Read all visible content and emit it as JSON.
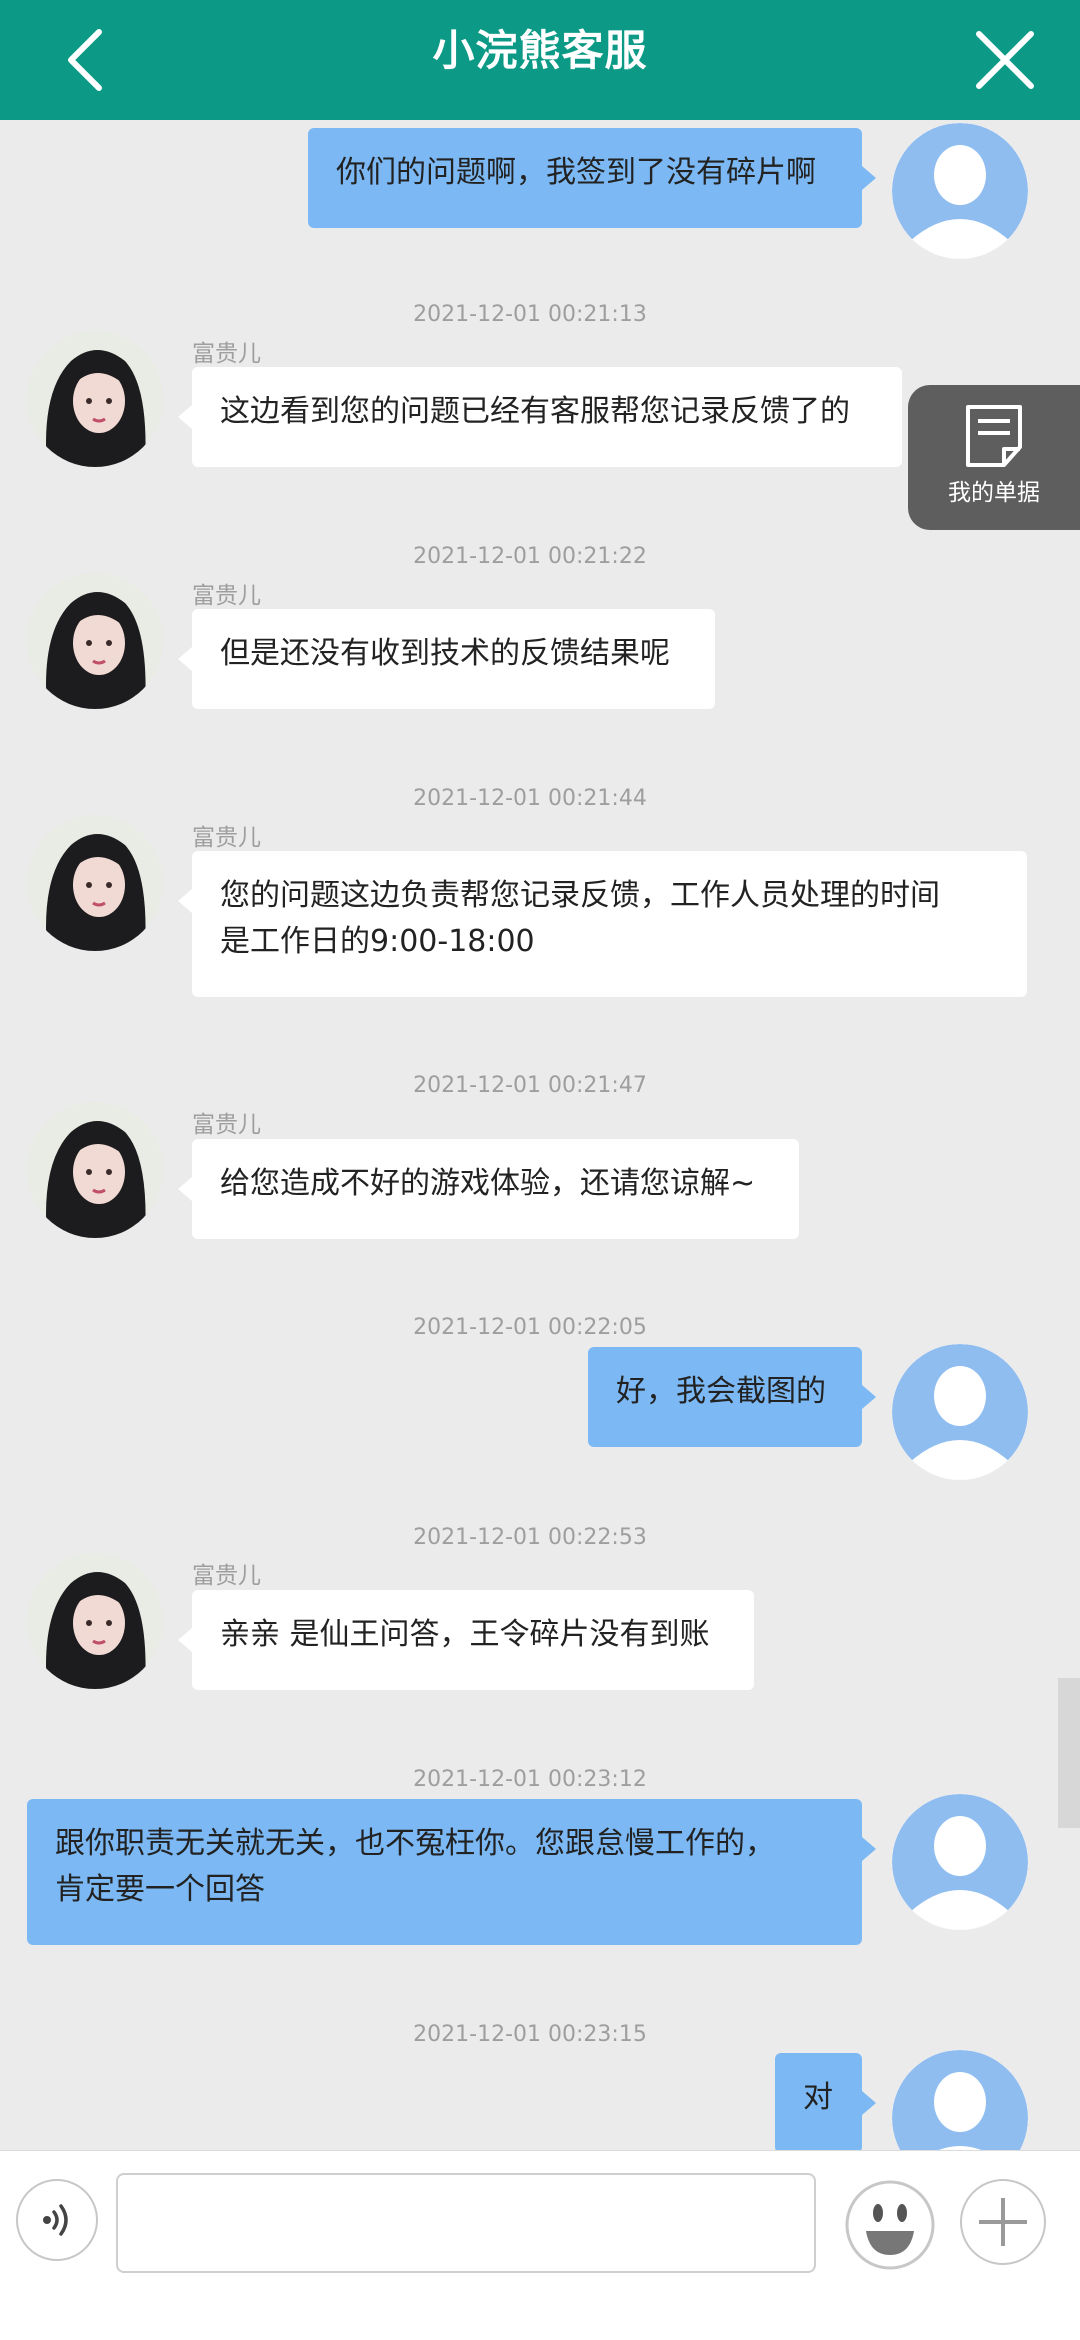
{
  "header": {
    "title": "小浣熊客服",
    "back_icon": "chevron-left-icon",
    "close_icon": "close-icon"
  },
  "float_button": {
    "label": "我的单据",
    "icon": "document-icon"
  },
  "messages": [
    {
      "role": "user",
      "text": "你们的问题啊，我签到了没有碎片啊"
    },
    {
      "role": "agent",
      "timestamp": "2021-12-01 00:21:13",
      "sender": "富贵儿",
      "text": "这边看到您的问题已经有客服帮您记录反馈了的"
    },
    {
      "role": "agent",
      "timestamp": "2021-12-01 00:21:22",
      "sender": "富贵儿",
      "text": "但是还没有收到技术的反馈结果呢"
    },
    {
      "role": "agent",
      "timestamp": "2021-12-01 00:21:44",
      "sender": "富贵儿",
      "text_line1": "您的问题这边负责帮您记录反馈，工作人员处理的时间",
      "text_line2": "是工作日的9:00-18:00"
    },
    {
      "role": "agent",
      "timestamp": "2021-12-01 00:21:47",
      "sender": "富贵儿",
      "text": "给您造成不好的游戏体验，还请您谅解~"
    },
    {
      "role": "user",
      "timestamp": "2021-12-01 00:22:05",
      "text": "好，我会截图的"
    },
    {
      "role": "agent",
      "timestamp": "2021-12-01 00:22:53",
      "sender": "富贵儿",
      "text": "亲亲 是仙王问答，王令碎片没有到账"
    },
    {
      "role": "user",
      "timestamp": "2021-12-01 00:23:12",
      "text_line1": "跟你职责无关就无关，也不冤枉你。您跟怠慢工作的，",
      "text_line2": "肯定要一个回答"
    },
    {
      "role": "user",
      "timestamp": "2021-12-01 00:23:15",
      "text": "对"
    }
  ],
  "input": {
    "value": "",
    "placeholder": ""
  },
  "colors": {
    "header": "#0c9a86",
    "user_bubble": "#7cb9f4",
    "agent_bubble": "#ffffff",
    "chat_bg": "#ebebeb"
  }
}
